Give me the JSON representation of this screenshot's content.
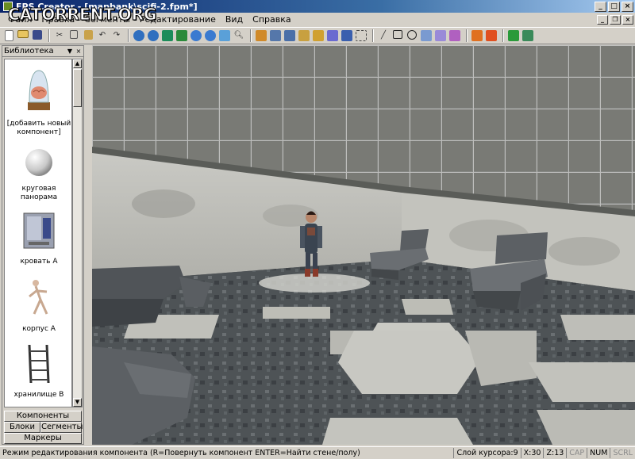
{
  "window": {
    "title": "FPS Creator - [mapbank\\scifi-2.fpm*]",
    "watermark": "CATORRENT.ORG"
  },
  "menu": {
    "items": [
      "Файл",
      "Правка",
      "Сегменты",
      "Редактирование",
      "Вид",
      "Справка"
    ]
  },
  "toolbar": {
    "icons": [
      "new-icon",
      "open-icon",
      "save-icon",
      "cut-icon",
      "copy-icon",
      "paste-icon",
      "undo-icon",
      "redo-icon",
      "zoom-in-icon",
      "zoom-out-icon",
      "view-icon",
      "grid-icon",
      "layer-up-icon",
      "layer-down-icon",
      "image-icon",
      "search-icon",
      "paint-icon",
      "fill-icon",
      "segment-icon",
      "brush-icon",
      "pencil-icon",
      "spray-icon",
      "marker-icon",
      "select-icon",
      "line-icon",
      "rect-icon",
      "circle-icon",
      "entity-icon",
      "light-icon",
      "script-icon",
      "flag-icon",
      "flags-icon",
      "test-icon",
      "build-icon"
    ]
  },
  "library": {
    "title": "Библиотека",
    "items": [
      {
        "label": "[добавить новый компонент]",
        "thumb": "brain-jar"
      },
      {
        "label": "круговая панорама",
        "thumb": "sphere"
      },
      {
        "label": "кровать A",
        "thumb": "bed"
      },
      {
        "label": "корпус A",
        "thumb": "body"
      },
      {
        "label": "хранилище B",
        "thumb": "shelf"
      }
    ],
    "tabs": {
      "components": "Компоненты",
      "blocks": "Блоки",
      "segments": "Сегменты",
      "markers": "Маркеры"
    }
  },
  "status": {
    "mode_text": "Режим редактирования компонента (R=Повернуть компонент ENTER=Найти стене/полу)",
    "cursor_layer": "Слой курсора:9",
    "x": "X:30",
    "z": "Z:13",
    "cap": "CAP",
    "num": "NUM",
    "scrl": "SCRL"
  },
  "colors": {
    "titlebar": "#0a246a",
    "ui_face": "#d4d0c8"
  }
}
